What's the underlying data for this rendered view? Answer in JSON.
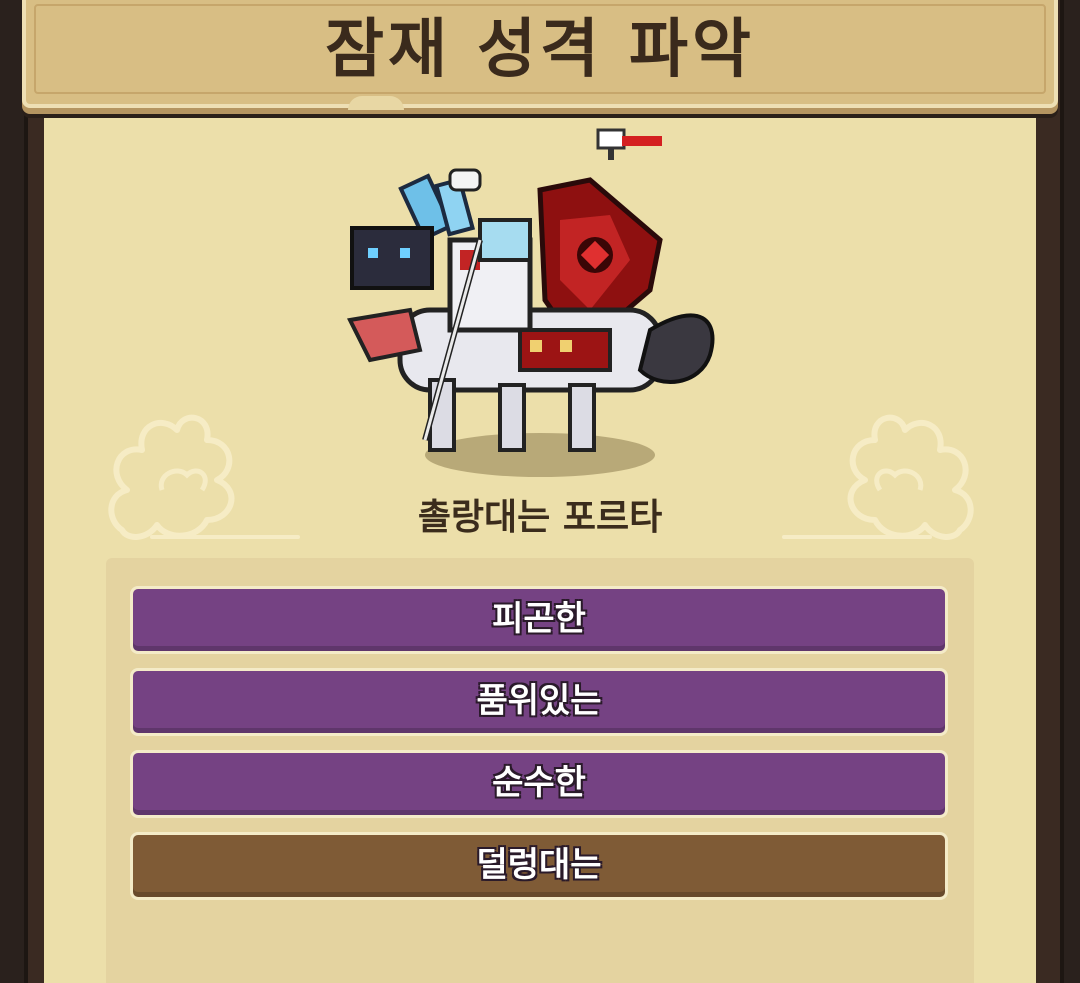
{
  "header": {
    "title": "잠재 성격 파악"
  },
  "character": {
    "name": "촐랑대는 포르타",
    "sprite_icon": "pixel-warrior-riding-wolf"
  },
  "options": [
    {
      "label": "피곤한",
      "color": "#754283"
    },
    {
      "label": "품위있는",
      "color": "#754283"
    },
    {
      "label": "순수한",
      "color": "#754283"
    },
    {
      "label": "덜렁대는",
      "color": "#7f5b36"
    }
  ],
  "colors": {
    "panel": "#ecdfaa",
    "title_bar": "#d8be84",
    "frame": "#3a2a22",
    "purple_option": "#754283",
    "brown_option": "#7f5b36"
  }
}
